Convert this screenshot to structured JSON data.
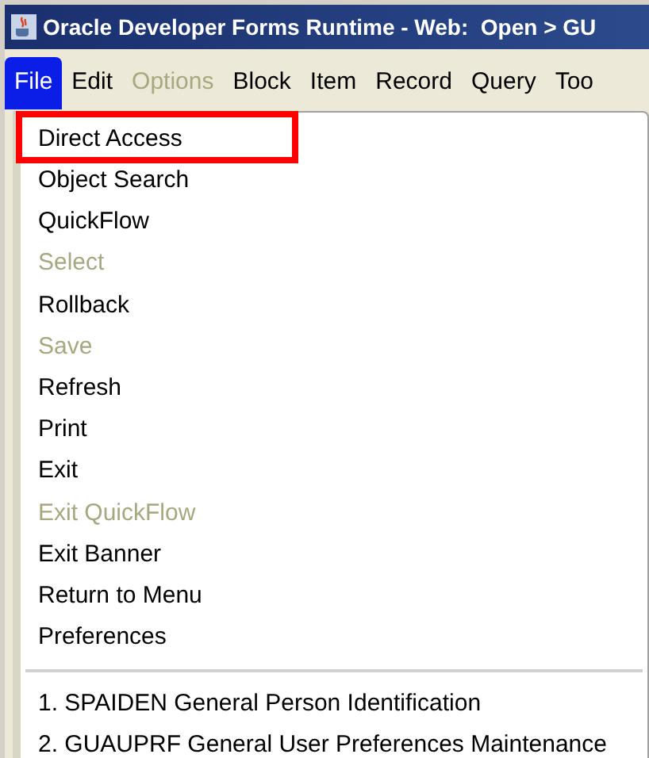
{
  "window": {
    "title": "Oracle Developer Forms Runtime - Web:  Open > GU"
  },
  "menu_bar": [
    {
      "label": "File",
      "selected": true,
      "disabled": false
    },
    {
      "label": "Edit",
      "selected": false,
      "disabled": false
    },
    {
      "label": "Options",
      "selected": false,
      "disabled": true
    },
    {
      "label": "Block",
      "selected": false,
      "disabled": false
    },
    {
      "label": "Item",
      "selected": false,
      "disabled": false
    },
    {
      "label": "Record",
      "selected": false,
      "disabled": false
    },
    {
      "label": "Query",
      "selected": false,
      "disabled": false
    },
    {
      "label": "Too",
      "selected": false,
      "disabled": false
    }
  ],
  "file_menu": [
    {
      "label": "Direct Access",
      "disabled": false,
      "highlighted": true
    },
    {
      "label": "Object Search",
      "disabled": false,
      "highlighted": false
    },
    {
      "label": "QuickFlow",
      "disabled": false,
      "highlighted": false
    },
    {
      "label": "Select",
      "disabled": true,
      "highlighted": false
    },
    {
      "label": "Rollback",
      "disabled": false,
      "highlighted": false
    },
    {
      "label": "Save",
      "disabled": true,
      "highlighted": false
    },
    {
      "label": "Refresh",
      "disabled": false,
      "highlighted": false
    },
    {
      "label": "Print",
      "disabled": false,
      "highlighted": false
    },
    {
      "label": "Exit",
      "disabled": false,
      "highlighted": false
    },
    {
      "label": "Exit QuickFlow",
      "disabled": true,
      "highlighted": false
    },
    {
      "label": "Exit Banner",
      "disabled": false,
      "highlighted": false
    },
    {
      "label": "Return to Menu",
      "disabled": false,
      "highlighted": false
    },
    {
      "label": "Preferences",
      "disabled": false,
      "highlighted": false
    }
  ],
  "recent_forms": [
    {
      "label": "1. SPAIDEN General Person Identification"
    },
    {
      "label": "2. GUAUPRF General User Preferences Maintenance"
    }
  ]
}
